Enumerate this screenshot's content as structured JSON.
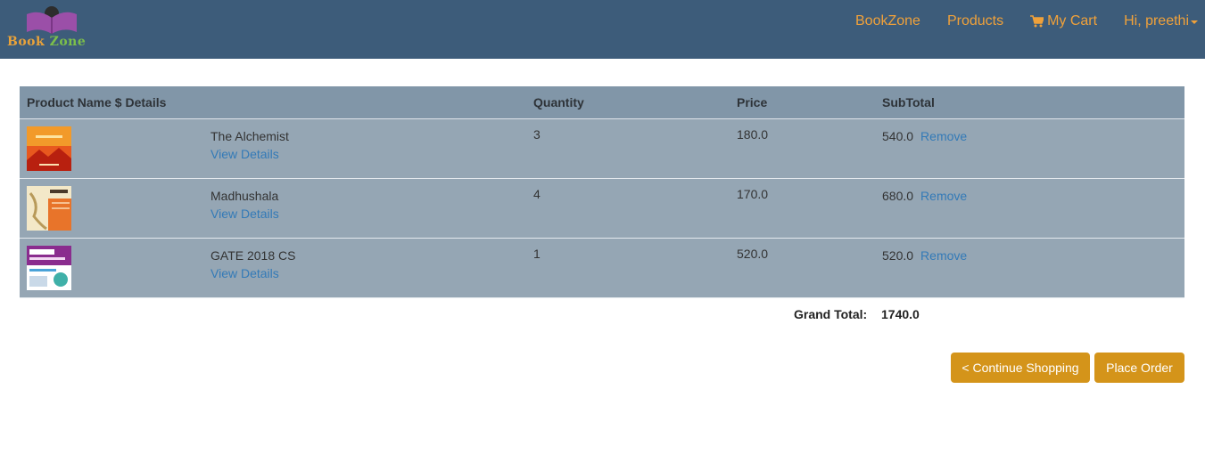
{
  "brand": {
    "logo_word1": "Book",
    "logo_word2": "Zone",
    "logo_colors": {
      "book": "#e8a23a",
      "zone": "#7cbf4a",
      "pages": "#9b4fa8",
      "reader": "#2d2d2d"
    }
  },
  "nav": {
    "background": "#3d5c7a",
    "link_color": "#f0a13a",
    "items": [
      {
        "label": "BookZone"
      },
      {
        "label": "Products"
      },
      {
        "label": "My Cart",
        "icon": "shopping-cart-icon"
      },
      {
        "label": "Hi, preethi",
        "icon": "caret-down-icon"
      }
    ]
  },
  "cart": {
    "columns": [
      "Product Name $ Details",
      "Quantity",
      "Price",
      "SubTotal"
    ],
    "rows": [
      {
        "name": "The Alchemist",
        "details_link": "View Details",
        "quantity": "3",
        "price": "180.0",
        "subtotal": "540.0",
        "remove_link": "Remove",
        "cover": "alchemist-cover"
      },
      {
        "name": "Madhushala",
        "details_link": "View Details",
        "quantity": "4",
        "price": "170.0",
        "subtotal": "680.0",
        "remove_link": "Remove",
        "cover": "madhushala-cover"
      },
      {
        "name": "GATE 2018 CS",
        "details_link": "View Details",
        "quantity": "1",
        "price": "520.0",
        "subtotal": "520.0",
        "remove_link": "Remove",
        "cover": "gate-cover"
      }
    ],
    "grand_total_label": "Grand Total:",
    "grand_total_value": "1740.0"
  },
  "actions": {
    "continue_label": "< Continue Shopping",
    "place_order_label": "Place Order",
    "button_color": "#d4941a"
  }
}
